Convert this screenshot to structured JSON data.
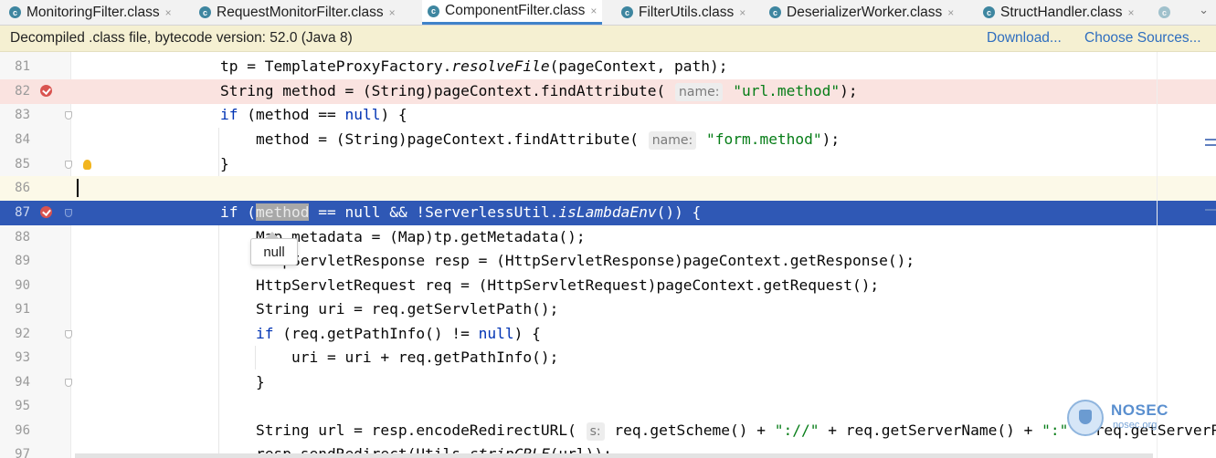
{
  "tabs": [
    {
      "label": "MonitoringFilter.class",
      "icon": "class-file-icon",
      "active": false
    },
    {
      "label": "RequestMonitorFilter.class",
      "icon": "class-file-icon",
      "active": false
    },
    {
      "label": "ComponentFilter.class",
      "icon": "class-file-icon",
      "active": true
    },
    {
      "label": "FilterUtils.class",
      "icon": "class-file-icon",
      "active": false
    },
    {
      "label": "DeserializerWorker.class",
      "icon": "class-file-icon",
      "active": false
    },
    {
      "label": "StructHandler.class",
      "icon": "class-file-icon",
      "active": false
    }
  ],
  "banner": {
    "message": "Decompiled .class file, bytecode version: 52.0 (Java 8)",
    "download": "Download...",
    "choose_sources": "Choose Sources..."
  },
  "editor": {
    "lines": [
      {
        "num": "81"
      },
      {
        "num": "82"
      },
      {
        "num": "83"
      },
      {
        "num": "84"
      },
      {
        "num": "85"
      },
      {
        "num": "86"
      },
      {
        "num": "87"
      },
      {
        "num": "88"
      },
      {
        "num": "89"
      },
      {
        "num": "90"
      },
      {
        "num": "91"
      },
      {
        "num": "92"
      },
      {
        "num": "93"
      },
      {
        "num": "94"
      },
      {
        "num": "95"
      },
      {
        "num": "96"
      },
      {
        "num": "97"
      }
    ],
    "tooltip": "null"
  },
  "watermark": {
    "brand": "NOSEC",
    "site": "nosec.org"
  },
  "colors": {
    "breakpoint_line": "#fae3e0",
    "current_line": "#fcf9e8",
    "selected_line": "#2f58b5",
    "keyword": "#0033b3",
    "string": "#067d17",
    "accent": "#4083c9"
  }
}
